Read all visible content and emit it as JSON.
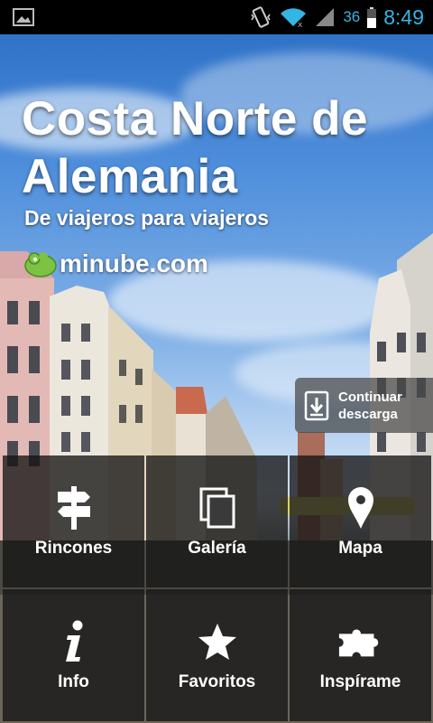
{
  "status_bar": {
    "battery_percent": "36",
    "time": "8:49"
  },
  "hero": {
    "title": "Costa Norte de Alemania",
    "subtitle": "De viajeros para viajeros",
    "brand": "minube.com"
  },
  "download": {
    "label": "Continuar descarga"
  },
  "menu": {
    "items": [
      {
        "label": "Rincones",
        "icon": "signpost-icon"
      },
      {
        "label": "Galería",
        "icon": "gallery-icon"
      },
      {
        "label": "Mapa",
        "icon": "map-pin-icon"
      },
      {
        "label": "Info",
        "icon": "info-icon"
      },
      {
        "label": "Favoritos",
        "icon": "star-icon"
      },
      {
        "label": "Inspírame",
        "icon": "puzzle-icon"
      }
    ]
  },
  "colors": {
    "status_accent": "#33b5e5",
    "tile_background": "#141414",
    "brand_green": "#7dc242"
  }
}
